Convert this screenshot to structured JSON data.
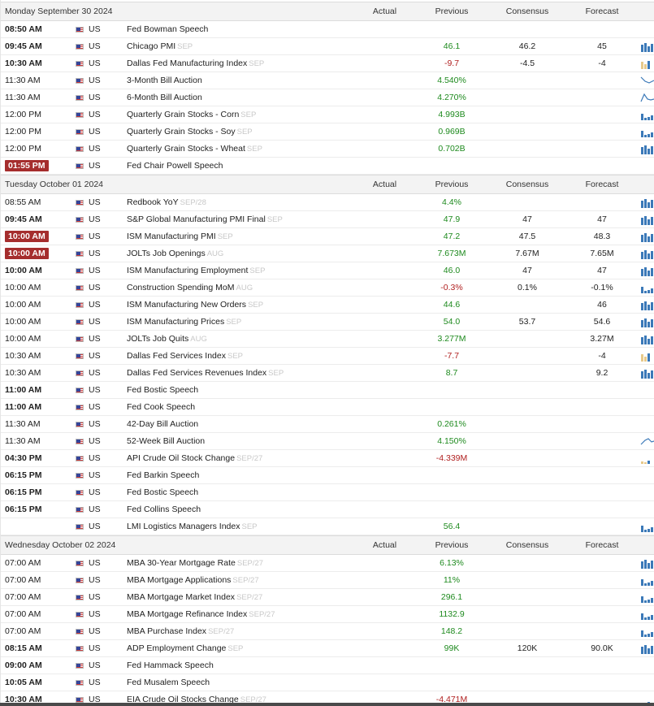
{
  "colors": {
    "positive": "#1e8a1e",
    "negative": "#b01f1f",
    "badge": "#a52d2d",
    "bar": "#3b79b8",
    "bar_light": "#e7c98a"
  },
  "icons": {
    "flag": "us-flag-icon"
  },
  "columns": {
    "actual": "Actual",
    "previous": "Previous",
    "consensus": "Consensus",
    "forecast": "Forecast"
  },
  "days": [
    {
      "title": "Monday September 30 2024",
      "events": [
        {
          "time": "08:50 AM",
          "bold": true,
          "country": "US",
          "name": "Fed Bowman Speech",
          "period": "",
          "previous": "",
          "prev_dir": "",
          "consensus": "",
          "forecast": "",
          "spark": ""
        },
        {
          "time": "09:45 AM",
          "bold": true,
          "country": "US",
          "name": "Chicago PMI",
          "period": "SEP",
          "previous": "46.1",
          "prev_dir": "pos",
          "consensus": "46.2",
          "forecast": "45",
          "spark": "bars"
        },
        {
          "time": "10:30 AM",
          "bold": true,
          "country": "US",
          "name": "Dallas Fed Manufacturing Index",
          "period": "SEP",
          "previous": "-9.7",
          "prev_dir": "neg",
          "consensus": "-4.5",
          "forecast": "-4",
          "spark": "neg"
        },
        {
          "time": "11:30 AM",
          "bold": false,
          "country": "US",
          "name": "3-Month Bill Auction",
          "period": "",
          "previous": "4.540%",
          "prev_dir": "pos",
          "consensus": "",
          "forecast": "",
          "spark": "line-down"
        },
        {
          "time": "11:30 AM",
          "bold": false,
          "country": "US",
          "name": "6-Month Bill Auction",
          "period": "",
          "previous": "4.270%",
          "prev_dir": "pos",
          "consensus": "",
          "forecast": "",
          "spark": "line-zig"
        },
        {
          "time": "12:00 PM",
          "bold": false,
          "country": "US",
          "name": "Quarterly Grain Stocks - Corn",
          "period": "SEP",
          "previous": "4.993B",
          "prev_dir": "pos",
          "consensus": "",
          "forecast": "",
          "spark": "bars-low"
        },
        {
          "time": "12:00 PM",
          "bold": false,
          "country": "US",
          "name": "Quarterly Grain Stocks - Soy",
          "period": "SEP",
          "previous": "0.969B",
          "prev_dir": "pos",
          "consensus": "",
          "forecast": "",
          "spark": "bars-low"
        },
        {
          "time": "12:00 PM",
          "bold": false,
          "country": "US",
          "name": "Quarterly Grain Stocks - Wheat",
          "period": "SEP",
          "previous": "0.702B",
          "prev_dir": "pos",
          "consensus": "",
          "forecast": "",
          "spark": "bars"
        },
        {
          "time": "01:55 PM",
          "badge": true,
          "bold": true,
          "country": "US",
          "name": "Fed Chair Powell Speech",
          "period": "",
          "previous": "",
          "prev_dir": "",
          "consensus": "",
          "forecast": "",
          "spark": ""
        }
      ]
    },
    {
      "title": "Tuesday October 01 2024",
      "events": [
        {
          "time": "08:55 AM",
          "bold": false,
          "country": "US",
          "name": "Redbook YoY",
          "period": "SEP/28",
          "previous": "4.4%",
          "prev_dir": "pos",
          "consensus": "",
          "forecast": "",
          "spark": "bars"
        },
        {
          "time": "09:45 AM",
          "bold": true,
          "country": "US",
          "name": "S&P Global Manufacturing PMI Final",
          "period": "SEP",
          "previous": "47.9",
          "prev_dir": "pos",
          "consensus": "47",
          "forecast": "47",
          "spark": "bars"
        },
        {
          "time": "10:00 AM",
          "badge": true,
          "bold": true,
          "country": "US",
          "name": "ISM Manufacturing PMI",
          "period": "SEP",
          "previous": "47.2",
          "prev_dir": "pos",
          "consensus": "47.5",
          "forecast": "48.3",
          "spark": "bars"
        },
        {
          "time": "10:00 AM",
          "badge": true,
          "bold": true,
          "country": "US",
          "name": "JOLTs Job Openings",
          "period": "AUG",
          "previous": "7.673M",
          "prev_dir": "pos",
          "consensus": "7.67M",
          "forecast": "7.65M",
          "spark": "bars"
        },
        {
          "time": "10:00 AM",
          "bold": true,
          "country": "US",
          "name": "ISM Manufacturing Employment",
          "period": "SEP",
          "previous": "46.0",
          "prev_dir": "pos",
          "consensus": "47",
          "forecast": "47",
          "spark": "bars"
        },
        {
          "time": "10:00 AM",
          "bold": false,
          "country": "US",
          "name": "Construction Spending MoM",
          "period": "AUG",
          "previous": "-0.3%",
          "prev_dir": "neg",
          "consensus": "0.1%",
          "forecast": "-0.1%",
          "spark": "bars-low"
        },
        {
          "time": "10:00 AM",
          "bold": false,
          "country": "US",
          "name": "ISM Manufacturing New Orders",
          "period": "SEP",
          "previous": "44.6",
          "prev_dir": "pos",
          "consensus": "",
          "forecast": "46",
          "spark": "bars"
        },
        {
          "time": "10:00 AM",
          "bold": false,
          "country": "US",
          "name": "ISM Manufacturing Prices",
          "period": "SEP",
          "previous": "54.0",
          "prev_dir": "pos",
          "consensus": "53.7",
          "forecast": "54.6",
          "spark": "bars"
        },
        {
          "time": "10:00 AM",
          "bold": false,
          "country": "US",
          "name": "JOLTs Job Quits",
          "period": "AUG",
          "previous": "3.277M",
          "prev_dir": "pos",
          "consensus": "",
          "forecast": "3.27M",
          "spark": "bars"
        },
        {
          "time": "10:30 AM",
          "bold": false,
          "country": "US",
          "name": "Dallas Fed Services Index",
          "period": "SEP",
          "previous": "-7.7",
          "prev_dir": "neg",
          "consensus": "",
          "forecast": "-4",
          "spark": "neg"
        },
        {
          "time": "10:30 AM",
          "bold": false,
          "country": "US",
          "name": "Dallas Fed Services Revenues Index",
          "period": "SEP",
          "previous": "8.7",
          "prev_dir": "pos",
          "consensus": "",
          "forecast": "9.2",
          "spark": "bars"
        },
        {
          "time": "11:00 AM",
          "bold": true,
          "country": "US",
          "name": "Fed Bostic Speech",
          "period": "",
          "previous": "",
          "prev_dir": "",
          "consensus": "",
          "forecast": "",
          "spark": ""
        },
        {
          "time": "11:00 AM",
          "bold": true,
          "country": "US",
          "name": "Fed Cook Speech",
          "period": "",
          "previous": "",
          "prev_dir": "",
          "consensus": "",
          "forecast": "",
          "spark": ""
        },
        {
          "time": "11:30 AM",
          "bold": false,
          "country": "US",
          "name": "42-Day Bill Auction",
          "period": "",
          "previous": "0.261%",
          "prev_dir": "pos",
          "consensus": "",
          "forecast": "",
          "spark": ""
        },
        {
          "time": "11:30 AM",
          "bold": false,
          "country": "US",
          "name": "52-Week Bill Auction",
          "period": "",
          "previous": "4.150%",
          "prev_dir": "pos",
          "consensus": "",
          "forecast": "",
          "spark": "line-up"
        },
        {
          "time": "04:30 PM",
          "bold": true,
          "country": "US",
          "name": "API Crude Oil Stock Change",
          "period": "SEP/27",
          "previous": "-4.339M",
          "prev_dir": "neg",
          "consensus": "",
          "forecast": "",
          "spark": "neg-small"
        },
        {
          "time": "06:15 PM",
          "bold": true,
          "country": "US",
          "name": "Fed Barkin Speech",
          "period": "",
          "previous": "",
          "prev_dir": "",
          "consensus": "",
          "forecast": "",
          "spark": ""
        },
        {
          "time": "06:15 PM",
          "bold": true,
          "country": "US",
          "name": "Fed Bostic Speech",
          "period": "",
          "previous": "",
          "prev_dir": "",
          "consensus": "",
          "forecast": "",
          "spark": ""
        },
        {
          "time": "06:15 PM",
          "bold": true,
          "country": "US",
          "name": "Fed Collins Speech",
          "period": "",
          "previous": "",
          "prev_dir": "",
          "consensus": "",
          "forecast": "",
          "spark": ""
        },
        {
          "time": "",
          "bold": false,
          "country": "US",
          "name": "LMI Logistics Managers Index",
          "period": "SEP",
          "previous": "56.4",
          "prev_dir": "pos",
          "consensus": "",
          "forecast": "",
          "spark": "bars-low"
        }
      ]
    },
    {
      "title": "Wednesday October 02 2024",
      "events": [
        {
          "time": "07:00 AM",
          "bold": false,
          "country": "US",
          "name": "MBA 30-Year Mortgage Rate",
          "period": "SEP/27",
          "previous": "6.13%",
          "prev_dir": "pos",
          "consensus": "",
          "forecast": "",
          "spark": "bars"
        },
        {
          "time": "07:00 AM",
          "bold": false,
          "country": "US",
          "name": "MBA Mortgage Applications",
          "period": "SEP/27",
          "previous": "11%",
          "prev_dir": "pos",
          "consensus": "",
          "forecast": "",
          "spark": "bars-low"
        },
        {
          "time": "07:00 AM",
          "bold": false,
          "country": "US",
          "name": "MBA Mortgage Market Index",
          "period": "SEP/27",
          "previous": "296.1",
          "prev_dir": "pos",
          "consensus": "",
          "forecast": "",
          "spark": "bars-low"
        },
        {
          "time": "07:00 AM",
          "bold": false,
          "country": "US",
          "name": "MBA Mortgage Refinance Index",
          "period": "SEP/27",
          "previous": "1132.9",
          "prev_dir": "pos",
          "consensus": "",
          "forecast": "",
          "spark": "bars-low"
        },
        {
          "time": "07:00 AM",
          "bold": false,
          "country": "US",
          "name": "MBA Purchase Index",
          "period": "SEP/27",
          "previous": "148.2",
          "prev_dir": "pos",
          "consensus": "",
          "forecast": "",
          "spark": "bars-low"
        },
        {
          "time": "08:15 AM",
          "bold": true,
          "country": "US",
          "name": "ADP Employment Change",
          "period": "SEP",
          "previous": "99K",
          "prev_dir": "pos",
          "consensus": "120K",
          "forecast": "90.0K",
          "spark": "bars"
        },
        {
          "time": "09:00 AM",
          "bold": true,
          "country": "US",
          "name": "Fed Hammack Speech",
          "period": "",
          "previous": "",
          "prev_dir": "",
          "consensus": "",
          "forecast": "",
          "spark": ""
        },
        {
          "time": "10:05 AM",
          "bold": true,
          "country": "US",
          "name": "Fed Musalem Speech",
          "period": "",
          "previous": "",
          "prev_dir": "",
          "consensus": "",
          "forecast": "",
          "spark": ""
        },
        {
          "time": "10:30 AM",
          "bold": true,
          "country": "US",
          "name": "EIA Crude Oil Stocks Change",
          "period": "SEP/27",
          "previous": "-4.471M",
          "prev_dir": "neg",
          "consensus": "",
          "forecast": "",
          "spark": "neg-small"
        }
      ]
    }
  ]
}
